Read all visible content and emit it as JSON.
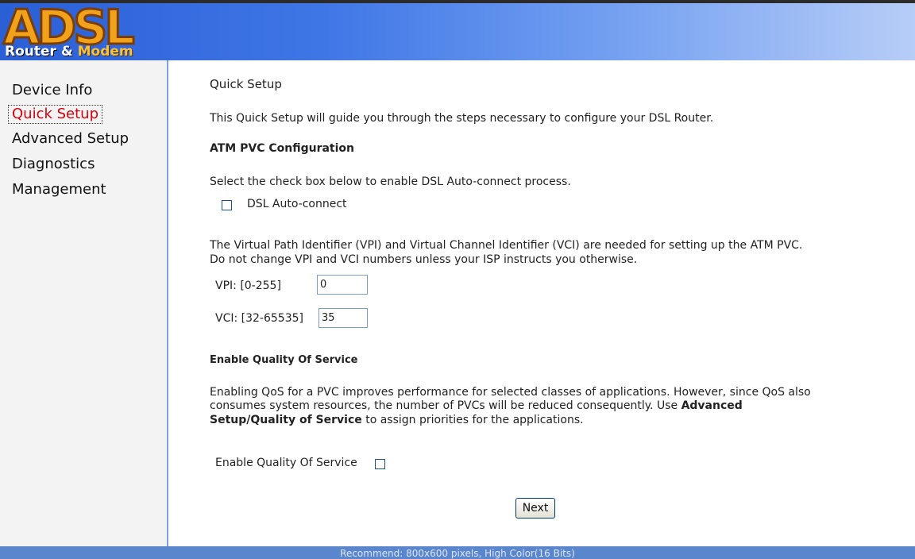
{
  "logo": {
    "letters": "ADSL",
    "subtitle_a": "Router",
    "subtitle_amp": " & ",
    "subtitle_b": "Modem"
  },
  "sidebar": {
    "items": [
      {
        "label": "Device Info"
      },
      {
        "label": "Quick Setup",
        "active": true
      },
      {
        "label": "Advanced Setup"
      },
      {
        "label": "Diagnostics"
      },
      {
        "label": "Management"
      }
    ]
  },
  "main": {
    "title": "Quick Setup",
    "intro": "This Quick Setup will guide you through the steps necessary to configure your DSL Router.",
    "atm_heading": "ATM PVC Configuration",
    "auto_instruction": "Select the check box below to enable DSL Auto-connect process.",
    "auto_label": "DSL Auto-connect",
    "auto_checked": false,
    "vpi_vci_line1": "The Virtual Path Identifier (VPI) and Virtual Channel Identifier (VCI) are needed for setting up the ATM PVC.",
    "vpi_vci_line2": "Do not change VPI and VCI numbers unless your ISP instructs you otherwise.",
    "vpi_label": "VPI: [0-255]",
    "vpi_value": "0",
    "vci_label": "VCI: [32-65535]",
    "vci_value": "35",
    "qos_heading": "Enable Quality Of Service",
    "qos_line1": "Enabling QoS for a PVC improves performance for selected classes of applications. However, since QoS also",
    "qos_line2_a": "consumes system resources, the number of PVCs will be reduced consequently. Use ",
    "qos_line2_b": "Advanced",
    "qos_line3_a": "Setup/Quality of Service",
    "qos_line3_b": " to assign priorities for the applications.",
    "qos_label": "Enable Quality Of Service",
    "qos_checked": false,
    "next_label": "Next"
  },
  "footer": {
    "text": "Recommend: 800x600 pixels, High Color(16 Bits)"
  },
  "colors": {
    "header_start": "#2a5fd6",
    "header_end": "#b7cdf7",
    "active_nav": "#d00010",
    "footer_bg": "#5a86cd"
  }
}
